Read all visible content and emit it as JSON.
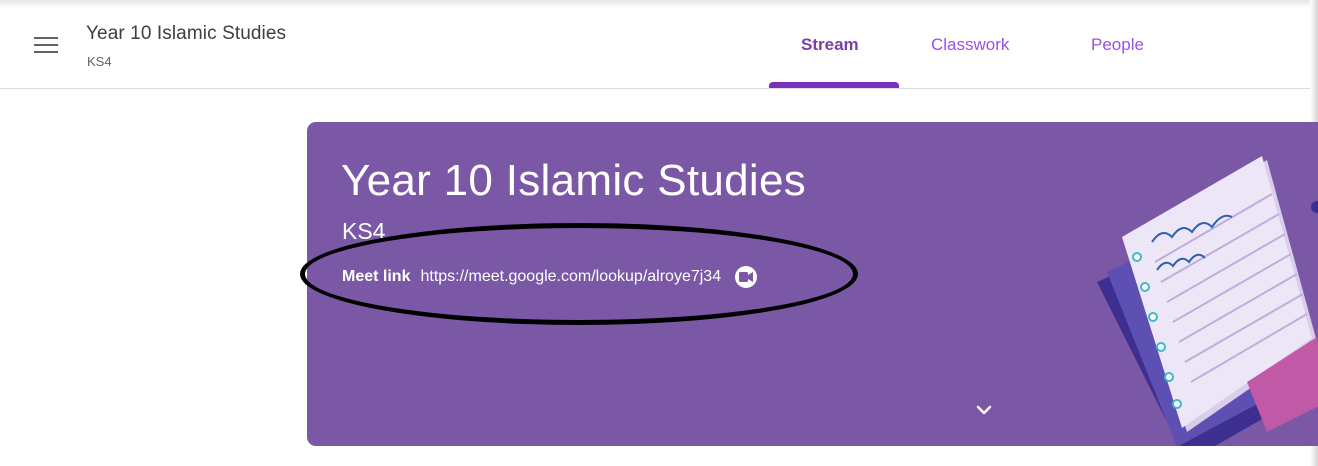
{
  "header": {
    "class_title": "Year 10 Islamic Studies",
    "class_subtitle": "KS4",
    "tabs": [
      {
        "label": "Stream",
        "active": true
      },
      {
        "label": "Classwork",
        "active": false
      },
      {
        "label": "People",
        "active": false
      }
    ]
  },
  "banner": {
    "title": "Year 10 Islamic Studies",
    "subtitle": "KS4",
    "meet_label": "Meet link",
    "meet_url": "https://meet.google.com/lookup/alroye7j34",
    "background_color": "#7b58a6"
  },
  "icons": {
    "menu": "hamburger-menu-icon",
    "video": "video-camera-icon",
    "expand": "chevron-down-icon"
  },
  "colors": {
    "accent": "#7b2fbf",
    "tab_text": "#9b51e0"
  }
}
